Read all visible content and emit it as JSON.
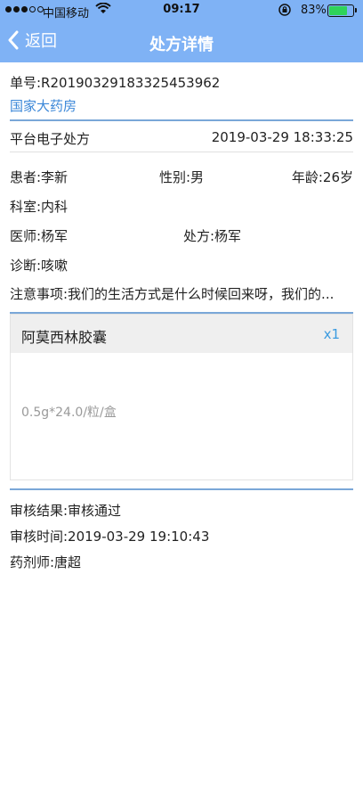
{
  "status_bar": {
    "carrier": "中国移动",
    "time": "09:17",
    "battery": "83%",
    "battery_level": 0.83,
    "icons": [
      "signal-dots-icon",
      "wifi-icon",
      "orientation-lock-icon",
      "battery-icon"
    ]
  },
  "nav": {
    "back_label": "返回",
    "title": "处方详情"
  },
  "order": {
    "number": "单号:R20190329183325453962",
    "pharmacy": "国家大药房",
    "source": "平台电子处方",
    "datetime": "2019-03-29 18:33:25"
  },
  "patient": {
    "name": "患者:李新",
    "gender": "性别:男",
    "age": "年龄:26岁",
    "department": "科室:内科",
    "doctor": "医师:杨军",
    "prescriber": "处方:杨军",
    "diagnosis": "诊断:咳嗽",
    "notes": "注意事项:我们的生活方式是什么时候回来呀，我们的..."
  },
  "medicine": {
    "name": "阿莫西林胶囊",
    "quantity": "x1",
    "spec": "0.5g*24.0/粒/盒"
  },
  "review": {
    "result": "审核结果:审核通过",
    "time": "审核时间:2019-03-29 19:10:43",
    "pharmacist": "药剂师:唐超"
  },
  "colors": {
    "nav_bg": "#7fb2f5",
    "link": "#3b87d8",
    "quantity": "#3b9be0",
    "divider": "#7aa7d8"
  }
}
